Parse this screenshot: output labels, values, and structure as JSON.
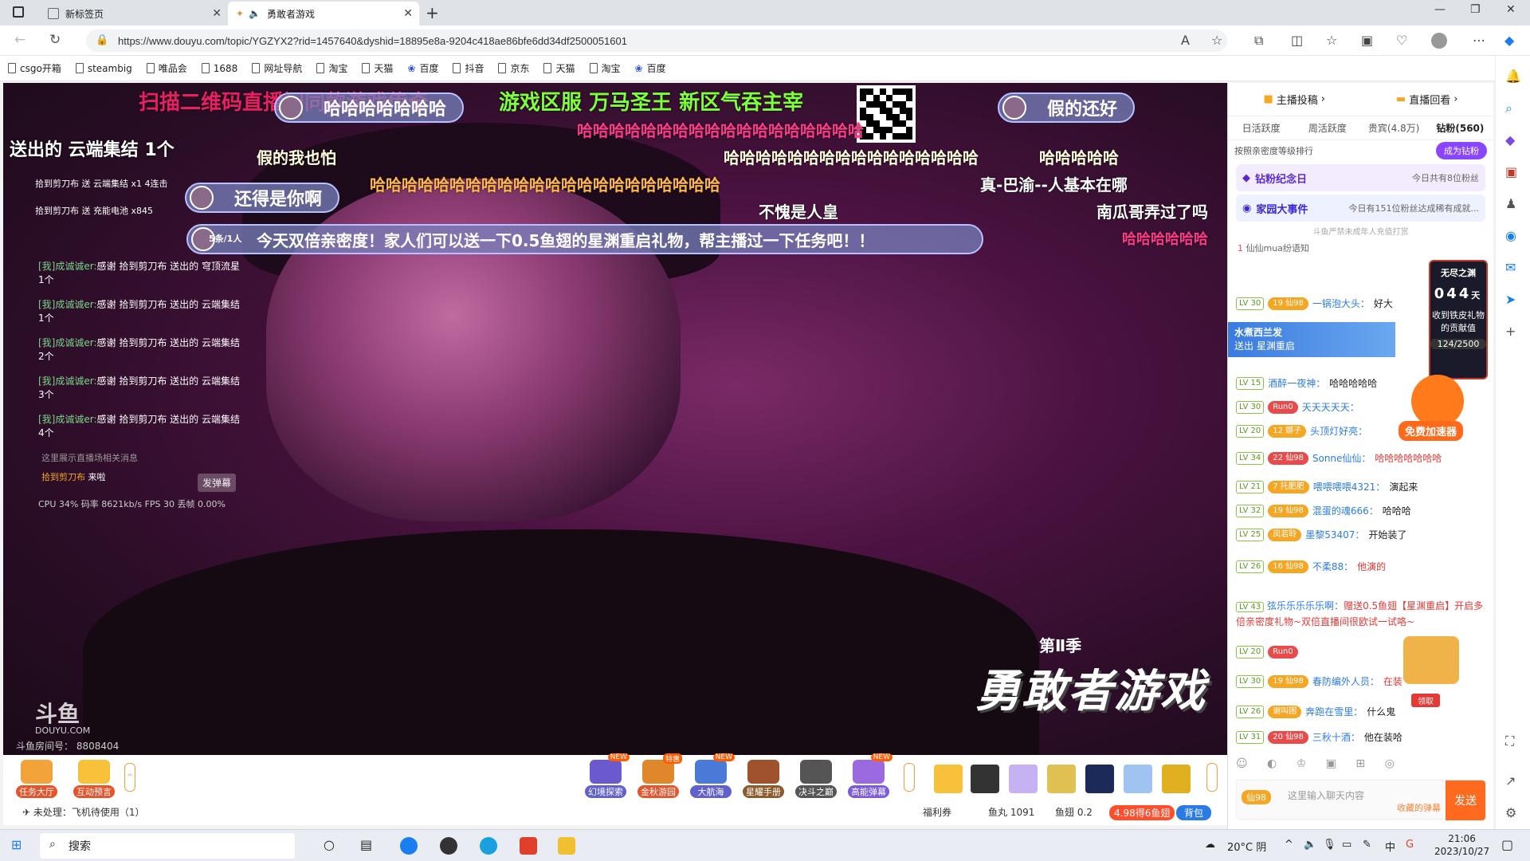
{
  "browser": {
    "tabs": [
      {
        "title": "新标签页"
      },
      {
        "title": "勇敢者游戏"
      }
    ],
    "url": "https://www.douyu.com/topic/YGZYX2?rid=1457640&dyshid=18895e8a-9204c418ae86bfe6dd34df2500051601",
    "bookmarks": [
      "csgo开箱",
      "steambig",
      "唯品会",
      "1688",
      "网址导航",
      "淘宝",
      "天猫",
      "百度",
      "抖音",
      "京东",
      "天猫",
      "淘宝",
      "百度"
    ]
  },
  "video": {
    "gift_banner": "送出的 云端集结 1个",
    "danmaku": [
      "扫描二维码直播间同款游戏传奇",
      "游戏区服 万马圣王 新区气吞主宰",
      "哈哈哈哈哈哈哈",
      "假的还好",
      "哈哈哈哈哈哈哈哈哈哈哈哈哈哈哈哈哈哈",
      "假的我也怕",
      "哈哈哈哈哈哈哈哈哈哈哈哈哈哈哈哈",
      "哈哈哈哈哈",
      "哈哈哈哈哈哈哈哈哈哈哈哈哈哈哈哈哈哈哈哈哈哈",
      "真-巴渝--人基本在哪",
      "还得是你啊",
      "不愧是人皇",
      "南瓜哥弄过了吗",
      "今天双倍亲密度！家人们可以送一下0.5鱼翅的星渊重启礼物，帮主播过一下任务吧！！",
      "哈哈哈哈哈哈"
    ],
    "danmaku_count": "5条/1人",
    "chat_overlay": [
      {
        "user": "[我]成诚诚er:",
        "text": "感谢 拾到剪刀布 送出的 穹顶流星 1个"
      },
      {
        "user": "[我]成诚诚er:",
        "text": "感谢 拾到剪刀布 送出的 云端集结 1个"
      },
      {
        "user": "[我]成诚诚er:",
        "text": "感谢 拾到剪刀布 送出的 云端集结 2个"
      },
      {
        "user": "[我]成诚诚er:",
        "text": "感谢 拾到剪刀布 送出的 云端集结 3个"
      },
      {
        "user": "[我]成诚诚er:",
        "text": "感谢 拾到剪刀布 送出的 云端集结 4个"
      }
    ],
    "gift_line": "拾到剪刀布 送 云端集结 x1 4连击",
    "gift_line2": "拾到剪刀布 送 充能电池 x845",
    "system_msg": "这里展示直播场相关消息",
    "arrive_user": "拾到剪刀布",
    "arrive_text": "来啦",
    "send_danmaku": "发弹幕",
    "stats": "CPU 34% 码率 8621kb/s FPS 30 丢帧 0.00%",
    "logo": "斗鱼",
    "logo_sub": "DOUYU.COM",
    "room_no": "斗鱼房间号： 8808404",
    "season": "第Ⅱ季",
    "show_title": "勇敢者游戏"
  },
  "bottom_bar": {
    "left_items": [
      "任务大厅",
      "互动预言"
    ],
    "unprocessed": "未处理：飞机待使用（1）",
    "gift_items": [
      "幻境探索",
      "金秋游园",
      "大航海",
      "星耀手册",
      "决斗之巅",
      "高能弹幕"
    ],
    "welfare": "福利券",
    "fish_ball": "鱼丸 1091",
    "fish_fin": "鱼翅 0.2",
    "promo": "4.98得6鱼翅",
    "backpack": "背包"
  },
  "sidebar": {
    "top": [
      "主播投稿",
      "直播回看"
    ],
    "tabs": [
      "日活跃度",
      "周活跃度",
      "贵宾(4.8万)",
      "钻粉(560)"
    ],
    "rank_label": "按照亲密度等级排行",
    "become_fan": "成为钻粉",
    "card1_title": "钻粉纪念日",
    "card1_note": "今日共有8位粉丝",
    "card2_title": "家园大事件",
    "card2_note": "今日有151位粉丝达成稀有成就...",
    "notice": "斗鱼严禁未成年人充值打赏",
    "rank_first": "仙仙mua纷语知",
    "float_user": "水煮西兰发",
    "float_text": "送出 星渊重启",
    "widget_title": "无尽之渊",
    "widget_timer": "044",
    "widget_unit": "天",
    "widget_desc": "收到铁皮礼物的贡献值",
    "widget_progress": "124/2500",
    "accel": "免费加速器",
    "claim": "领取",
    "messages": [
      {
        "lv": "LV 30",
        "fan": "19 仙98",
        "name": "一锅泡大头：",
        "text": "好大",
        "red": false
      },
      {
        "lv": "LV 15",
        "fan": "",
        "name": "酒醉一夜神：",
        "text": "哈哈哈哈哈",
        "red": false
      },
      {
        "lv": "LV 30",
        "fan": "Run0",
        "name": "天天天天天：",
        "text": "",
        "red": false
      },
      {
        "lv": "LV 20",
        "fan": "12 娜子",
        "name": "头顶灯好亮：",
        "text": "",
        "red": false
      },
      {
        "lv": "LV 34",
        "fan": "22 仙98",
        "name": "Sonne仙仙：",
        "text": "哈哈哈哈哈哈哈",
        "red": true
      },
      {
        "lv": "LV 21",
        "fan": "7 托肥肥",
        "name": "喂喂喂喂4321：",
        "text": "演起来",
        "red": false
      },
      {
        "lv": "LV 32",
        "fan": "19 仙98",
        "name": "混蛋的魂666：",
        "text": "哈哈哈",
        "red": false
      },
      {
        "lv": "LV 25",
        "fan": "凤若聆",
        "name": "墨黎53407：",
        "text": "开始装了",
        "red": false
      },
      {
        "lv": "LV 26",
        "fan": "16 仙98",
        "name": "不柔88：",
        "text": "他演的",
        "red": true
      },
      {
        "lv": "LV 43",
        "fan": "",
        "name": "弦乐乐乐乐乐啊：",
        "text": "赠送0.5鱼翅【星渊重启】开启多倍亲密度礼物~双倍直播间很欧试一试咯~",
        "red": true
      },
      {
        "lv": "LV 20",
        "fan": "Run0",
        "name": "",
        "text": "",
        "red": false
      },
      {
        "lv": "LV 30",
        "fan": "19 仙98",
        "name": "春防编外人员：",
        "text": "在装",
        "red": false
      },
      {
        "lv": "LV 26",
        "fan": "谢叫困",
        "name": "奔跑在雪里：",
        "text": "什么鬼",
        "red": false
      },
      {
        "lv": "LV 31",
        "fan": "20 仙98",
        "name": "三秋十酒：",
        "text": "他在装哈",
        "red": false
      }
    ],
    "input_placeholder": "这里输入聊天内容",
    "input_fan": "仙98",
    "input_hint": "收藏的弹幕",
    "send": "发送"
  },
  "taskbar": {
    "search": "搜索",
    "weather": "20°C 阴",
    "ime": "中",
    "time": "21:06",
    "date": "2023/10/27"
  }
}
